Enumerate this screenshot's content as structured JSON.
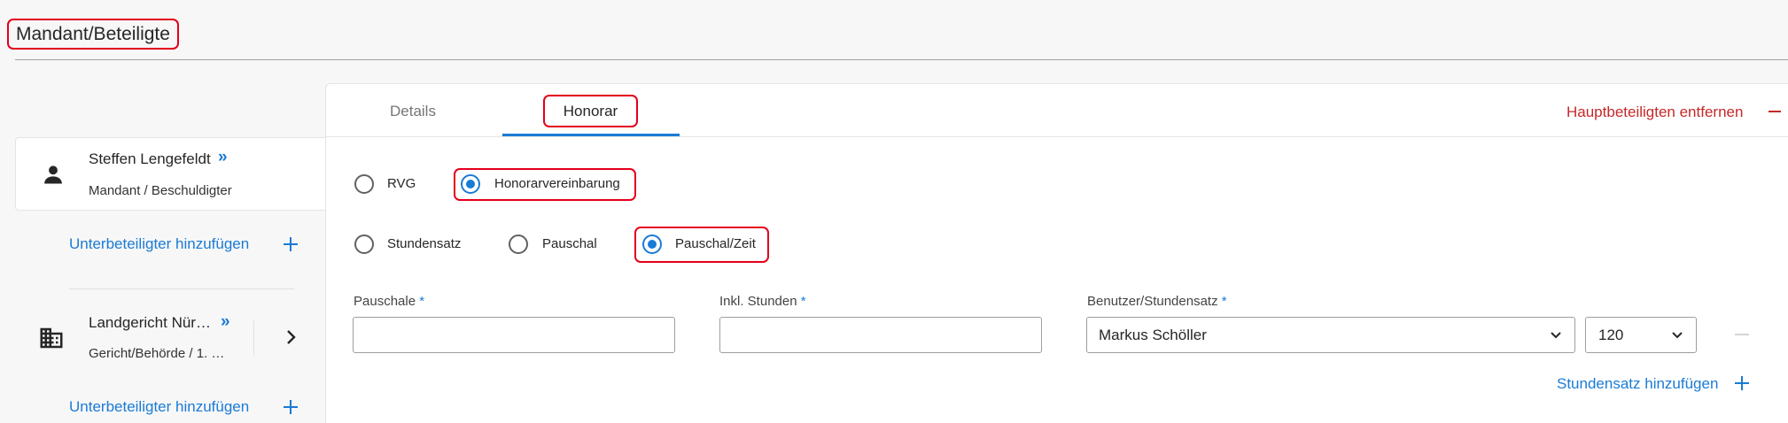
{
  "header": {
    "title": "Mandant/Beteiligte"
  },
  "sidebar": {
    "parties": [
      {
        "name": "Steffen Lengefeldt",
        "role": "Mandant / Beschuldigter",
        "icon": "person-icon"
      },
      {
        "name": "Landgericht Nür…",
        "role": "Gericht/Behörde / 1. …",
        "icon": "building-icon"
      }
    ],
    "add_sub_label": "Unterbeteiligter hinzufügen",
    "chevron_double": "»"
  },
  "tabs": [
    {
      "label": "Details",
      "active": false
    },
    {
      "label": "Honorar",
      "active": true
    }
  ],
  "remove_main_label": "Hauptbeteiligten entfernen",
  "billing": {
    "mode_options": [
      {
        "label": "RVG",
        "checked": false
      },
      {
        "label": "Honorarvereinbarung",
        "checked": true
      }
    ],
    "type_options": [
      {
        "label": "Stundensatz",
        "checked": false
      },
      {
        "label": "Pauschal",
        "checked": false
      },
      {
        "label": "Pauschal/Zeit",
        "checked": true
      }
    ],
    "fields": {
      "pauschale": {
        "label": "Pauschale",
        "required": "*",
        "value": ""
      },
      "inkl_stunden": {
        "label": "Inkl. Stunden",
        "required": "*",
        "value": ""
      },
      "benutzer": {
        "label": "Benutzer/Stundensatz",
        "required": "*",
        "user": "Markus Schöller",
        "rate": "120"
      }
    },
    "add_rate_label": "Stundensatz hinzufügen"
  },
  "colors": {
    "accent": "#1a7bd6",
    "danger": "#c62828",
    "highlight": "#e3001b"
  }
}
